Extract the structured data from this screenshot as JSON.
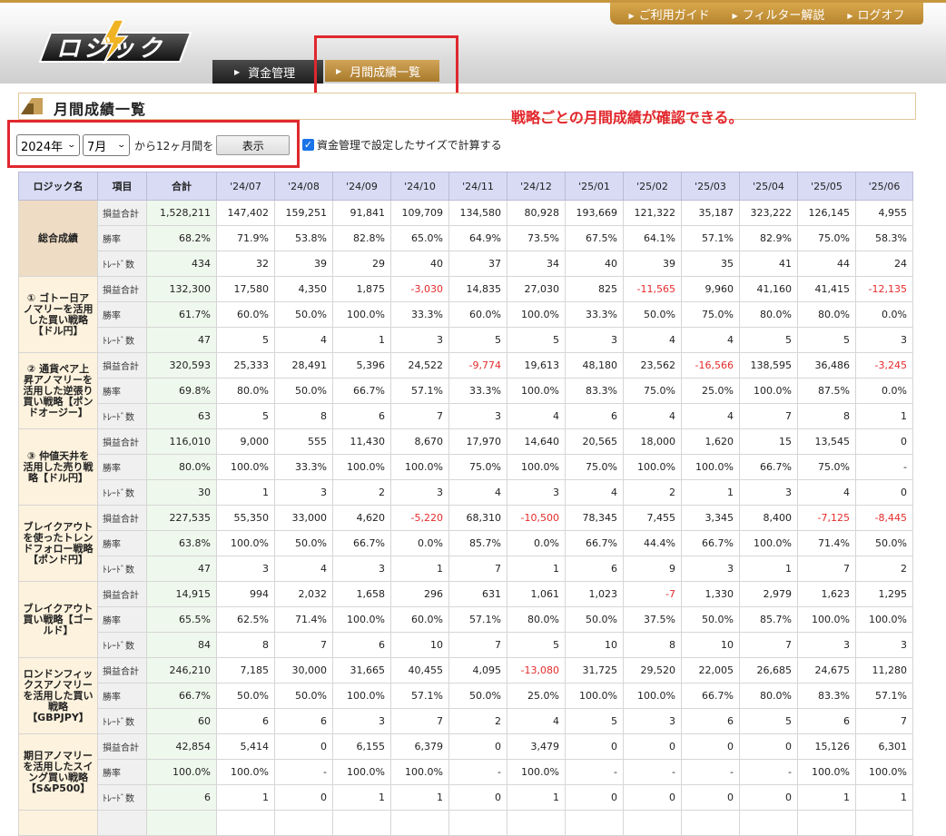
{
  "header": {
    "logo_text": "ロジック",
    "top_nav": [
      "ご利用ガイド",
      "フィルター解説",
      "ログオフ"
    ],
    "tabs": [
      {
        "label": "資金管理"
      },
      {
        "label": "月間成績一覧"
      }
    ]
  },
  "page": {
    "title": "月間成績一覧",
    "annotation": "戦略ごとの月間成績が確認できる。"
  },
  "controls": {
    "year": "2024年",
    "month": "7月",
    "range_text": "から12ヶ月間を",
    "show_button": "表示",
    "checkbox_label": "資金管理で設定したサイズで計算する",
    "checkbox_checked": true
  },
  "colors": {
    "negative": "#e52b2b",
    "header_bg": "#d9dbf5",
    "name_bg": "#fdf2dd",
    "total_name_bg": "#efdcc4",
    "sum_bg": "#eef8ec",
    "annotation": "#e2262c"
  },
  "table": {
    "headers": [
      "ロジック名",
      "項目",
      "合計",
      "'24/07",
      "'24/08",
      "'24/09",
      "'24/10",
      "'24/11",
      "'24/12",
      "'25/01",
      "'25/02",
      "'25/03",
      "'25/04",
      "'25/05",
      "'25/06"
    ],
    "strategies": [
      {
        "name": "総合成績",
        "rows": [
          {
            "item": "損益合計",
            "values": [
              "1,528,211",
              "147,402",
              "159,251",
              "91,841",
              "109,709",
              "134,580",
              "80,928",
              "193,669",
              "121,322",
              "35,187",
              "323,222",
              "126,145",
              "4,955"
            ]
          },
          {
            "item": "勝率",
            "values": [
              "68.2%",
              "71.9%",
              "53.8%",
              "82.8%",
              "65.0%",
              "64.9%",
              "73.5%",
              "67.5%",
              "64.1%",
              "57.1%",
              "82.9%",
              "75.0%",
              "58.3%"
            ]
          },
          {
            "item": "ﾄﾚｰﾄﾞ数",
            "values": [
              "434",
              "32",
              "39",
              "29",
              "40",
              "37",
              "34",
              "40",
              "39",
              "35",
              "41",
              "44",
              "24"
            ]
          }
        ]
      },
      {
        "name": "① ゴトー日アノマリーを活用した買い戦略【ドル円】",
        "rows": [
          {
            "item": "損益合計",
            "values": [
              "132,300",
              "17,580",
              "4,350",
              "1,875",
              "-3,030",
              "14,835",
              "27,030",
              "825",
              "-11,565",
              "9,960",
              "41,160",
              "41,415",
              "-12,135"
            ]
          },
          {
            "item": "勝率",
            "values": [
              "61.7%",
              "60.0%",
              "50.0%",
              "100.0%",
              "33.3%",
              "60.0%",
              "100.0%",
              "33.3%",
              "50.0%",
              "75.0%",
              "80.0%",
              "80.0%",
              "0.0%"
            ]
          },
          {
            "item": "ﾄﾚｰﾄﾞ数",
            "values": [
              "47",
              "5",
              "4",
              "1",
              "3",
              "5",
              "5",
              "3",
              "4",
              "4",
              "5",
              "5",
              "3"
            ]
          }
        ]
      },
      {
        "name": "② 通貨ペア上昇アノマリーを活用した逆張り買い戦略【ポンドオージー】",
        "rows": [
          {
            "item": "損益合計",
            "values": [
              "320,593",
              "25,333",
              "28,491",
              "5,396",
              "24,522",
              "-9,774",
              "19,613",
              "48,180",
              "23,562",
              "-16,566",
              "138,595",
              "36,486",
              "-3,245"
            ]
          },
          {
            "item": "勝率",
            "values": [
              "69.8%",
              "80.0%",
              "50.0%",
              "66.7%",
              "57.1%",
              "33.3%",
              "100.0%",
              "83.3%",
              "75.0%",
              "25.0%",
              "100.0%",
              "87.5%",
              "0.0%"
            ]
          },
          {
            "item": "ﾄﾚｰﾄﾞ数",
            "values": [
              "63",
              "5",
              "8",
              "6",
              "7",
              "3",
              "4",
              "6",
              "4",
              "4",
              "7",
              "8",
              "1"
            ]
          }
        ]
      },
      {
        "name": "③ 仲値天井を活用した売り戦略【ドル円】",
        "rows": [
          {
            "item": "損益合計",
            "values": [
              "116,010",
              "9,000",
              "555",
              "11,430",
              "8,670",
              "17,970",
              "14,640",
              "20,565",
              "18,000",
              "1,620",
              "15",
              "13,545",
              "0"
            ]
          },
          {
            "item": "勝率",
            "values": [
              "80.0%",
              "100.0%",
              "33.3%",
              "100.0%",
              "100.0%",
              "75.0%",
              "100.0%",
              "75.0%",
              "100.0%",
              "100.0%",
              "66.7%",
              "75.0%",
              "-"
            ]
          },
          {
            "item": "ﾄﾚｰﾄﾞ数",
            "values": [
              "30",
              "1",
              "3",
              "2",
              "3",
              "4",
              "3",
              "4",
              "2",
              "1",
              "3",
              "4",
              "0"
            ]
          }
        ]
      },
      {
        "name": "ブレイクアウトを使ったトレンドフォロー戦略【ポンド円】",
        "rows": [
          {
            "item": "損益合計",
            "values": [
              "227,535",
              "55,350",
              "33,000",
              "4,620",
              "-5,220",
              "68,310",
              "-10,500",
              "78,345",
              "7,455",
              "3,345",
              "8,400",
              "-7,125",
              "-8,445"
            ]
          },
          {
            "item": "勝率",
            "values": [
              "63.8%",
              "100.0%",
              "50.0%",
              "66.7%",
              "0.0%",
              "85.7%",
              "0.0%",
              "66.7%",
              "44.4%",
              "66.7%",
              "100.0%",
              "71.4%",
              "50.0%"
            ]
          },
          {
            "item": "ﾄﾚｰﾄﾞ数",
            "values": [
              "47",
              "3",
              "4",
              "3",
              "1",
              "7",
              "1",
              "6",
              "9",
              "3",
              "1",
              "7",
              "2"
            ]
          }
        ]
      },
      {
        "name": "ブレイクアウト買い戦略【ゴールド】",
        "rows": [
          {
            "item": "損益合計",
            "values": [
              "14,915",
              "994",
              "2,032",
              "1,658",
              "296",
              "631",
              "1,061",
              "1,023",
              "-7",
              "1,330",
              "2,979",
              "1,623",
              "1,295"
            ]
          },
          {
            "item": "勝率",
            "values": [
              "65.5%",
              "62.5%",
              "71.4%",
              "100.0%",
              "60.0%",
              "57.1%",
              "80.0%",
              "50.0%",
              "37.5%",
              "50.0%",
              "85.7%",
              "100.0%",
              "100.0%"
            ]
          },
          {
            "item": "ﾄﾚｰﾄﾞ数",
            "values": [
              "84",
              "8",
              "7",
              "6",
              "10",
              "7",
              "5",
              "10",
              "8",
              "10",
              "7",
              "3",
              "3"
            ]
          }
        ]
      },
      {
        "name": "ロンドンフィックスアノマリーを活用した買い戦略【GBPJPY】",
        "rows": [
          {
            "item": "損益合計",
            "values": [
              "246,210",
              "7,185",
              "30,000",
              "31,665",
              "40,455",
              "4,095",
              "-13,080",
              "31,725",
              "29,520",
              "22,005",
              "26,685",
              "24,675",
              "11,280"
            ]
          },
          {
            "item": "勝率",
            "values": [
              "66.7%",
              "50.0%",
              "50.0%",
              "100.0%",
              "57.1%",
              "50.0%",
              "25.0%",
              "100.0%",
              "100.0%",
              "66.7%",
              "80.0%",
              "83.3%",
              "57.1%"
            ]
          },
          {
            "item": "ﾄﾚｰﾄﾞ数",
            "values": [
              "60",
              "6",
              "6",
              "3",
              "7",
              "2",
              "4",
              "5",
              "3",
              "6",
              "5",
              "6",
              "7"
            ]
          }
        ]
      },
      {
        "name": "期日アノマリーを活用したスイング買い戦略【S&P500】",
        "rows": [
          {
            "item": "損益合計",
            "values": [
              "42,854",
              "5,414",
              "0",
              "6,155",
              "6,379",
              "0",
              "3,479",
              "0",
              "0",
              "0",
              "0",
              "15,126",
              "6,301"
            ]
          },
          {
            "item": "勝率",
            "values": [
              "100.0%",
              "100.0%",
              "-",
              "100.0%",
              "100.0%",
              "-",
              "100.0%",
              "-",
              "-",
              "-",
              "-",
              "100.0%",
              "100.0%"
            ]
          },
          {
            "item": "ﾄﾚｰﾄﾞ数",
            "values": [
              "6",
              "1",
              "0",
              "1",
              "1",
              "0",
              "1",
              "0",
              "0",
              "0",
              "0",
              "1",
              "1"
            ]
          }
        ]
      },
      {
        "name": "",
        "rows": [
          {
            "item": "",
            "values": [
              "",
              "",
              "",
              "",
              "",
              "",
              "",
              "",
              "",
              "",
              "",
              "",
              ""
            ]
          }
        ]
      }
    ]
  }
}
